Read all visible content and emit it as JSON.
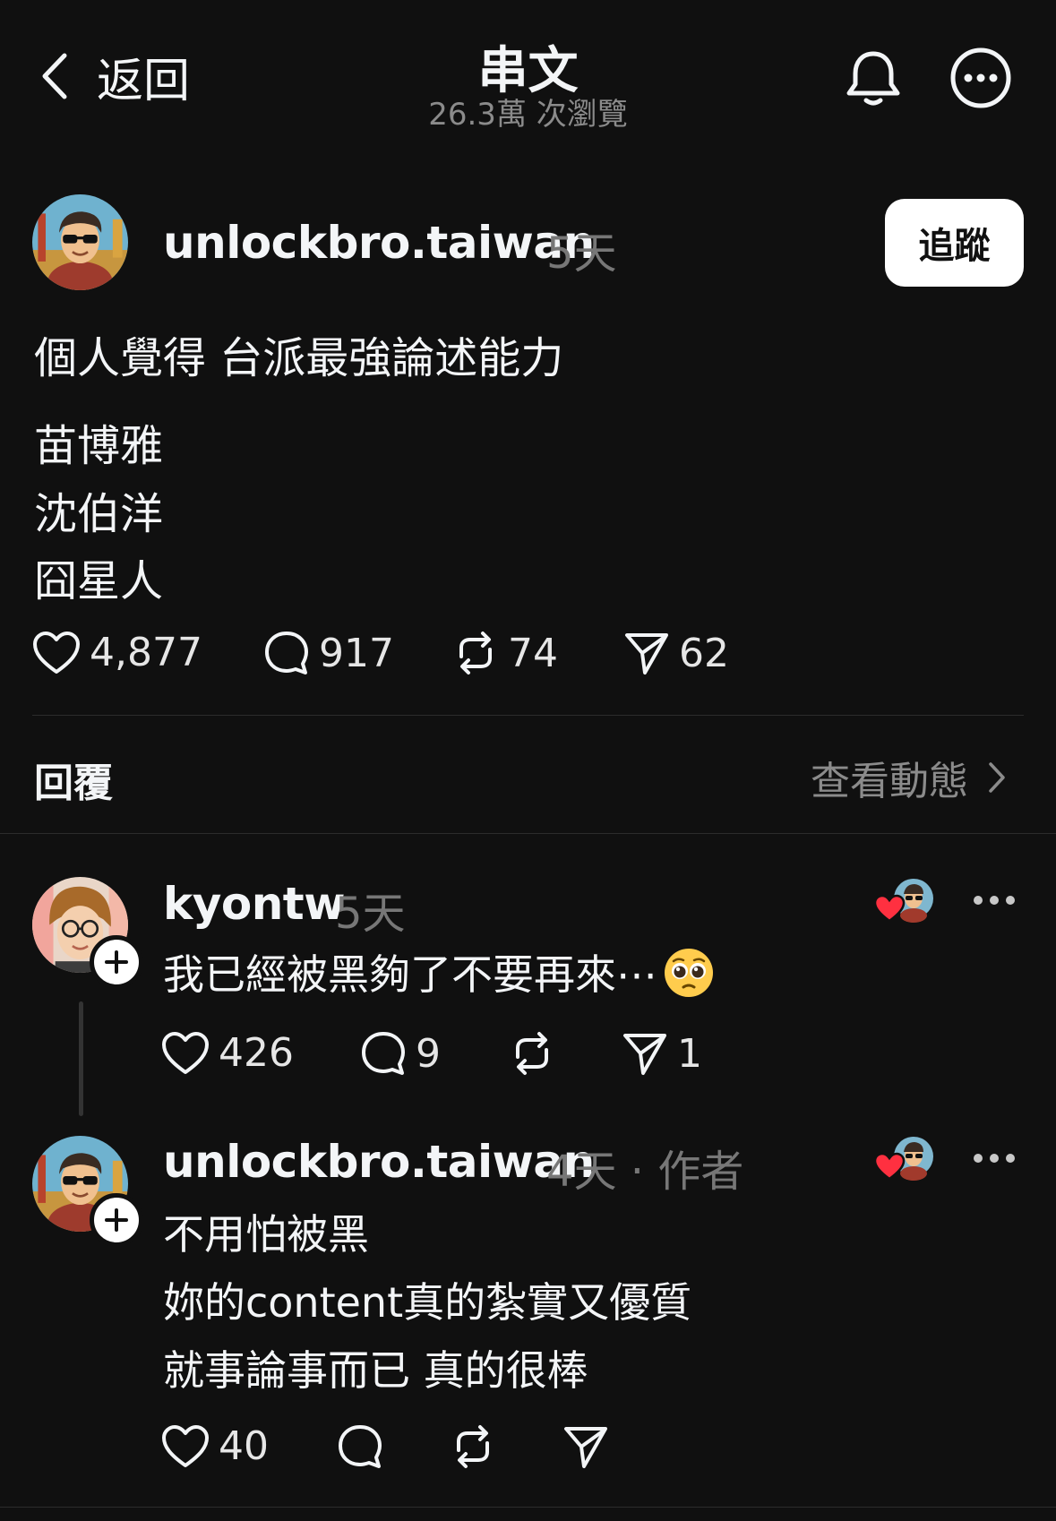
{
  "header": {
    "back_label": "返回",
    "title": "串文",
    "subtitle": "26.3萬 次瀏覽"
  },
  "post": {
    "username": "unlockbro.taiwan",
    "time": "5天",
    "follow_label": "追蹤",
    "lines": [
      "個人覺得 台派最強論述能力",
      "苗博雅",
      "沈伯洋",
      "囧星人"
    ],
    "likes": "4,877",
    "comments": "917",
    "reposts": "74",
    "shares": "62"
  },
  "replies_section": {
    "label": "回覆",
    "activity_label": "查看動態"
  },
  "replies": [
    {
      "username": "kyontw",
      "meta": "5天",
      "text": "我已經被黑夠了不要再來⋯",
      "likes": "426",
      "comments": "9",
      "reposts": "",
      "shares": "1"
    },
    {
      "username": "unlockbro.taiwan",
      "meta": "4天 · 作者",
      "lines": [
        "不用怕被黑",
        "妳的content真的紮實又優質",
        "就事論事而已 真的很棒"
      ],
      "likes": "40",
      "comments": "",
      "reposts": "",
      "shares": ""
    }
  ],
  "colors": {
    "background": "#101010",
    "text": "#f3f5f7",
    "muted": "#777777",
    "heart": "#ff3040"
  },
  "icons": [
    "chevron-left-icon",
    "bell-icon",
    "more-circle-icon",
    "heart-icon",
    "comment-icon",
    "repost-icon",
    "share-icon",
    "chevron-right-icon",
    "plus-icon",
    "pleading-face-emoji"
  ]
}
